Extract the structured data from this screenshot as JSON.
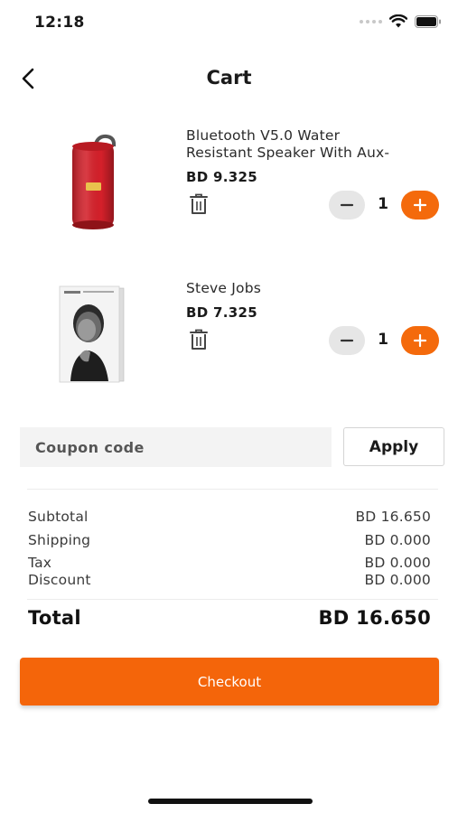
{
  "status_bar": {
    "time": "12:18"
  },
  "header": {
    "title": "Cart",
    "back_icon": "chevron-left-icon"
  },
  "cart": {
    "items": [
      {
        "title_line1": "Bluetooth V5.0 Water",
        "title_line2": "Resistant Speaker With Aux-",
        "price": "BD 9.325",
        "quantity": "1",
        "image_icon": "red-bluetooth-speaker"
      },
      {
        "title_line1": "Steve Jobs",
        "title_line2": "",
        "price": "BD 7.325",
        "quantity": "1",
        "image_icon": "steve-jobs-book-cover"
      }
    ]
  },
  "coupon": {
    "placeholder": "Coupon code",
    "apply_label": "Apply"
  },
  "summary": {
    "subtotal_label": "Subtotal",
    "subtotal_value": "BD 16.650",
    "shipping_label": "Shipping",
    "shipping_value": "BD 0.000",
    "tax_label": "Tax",
    "tax_value": "BD 0.000",
    "discount_label": "Discount",
    "discount_value": "BD 0.000",
    "total_label": "Total",
    "total_value": "BD 16.650"
  },
  "checkout": {
    "label": "Checkout"
  },
  "colors": {
    "accent": "#f4650a",
    "minus_bg": "#e6e6e6",
    "coupon_bg": "#f3f3f3"
  }
}
